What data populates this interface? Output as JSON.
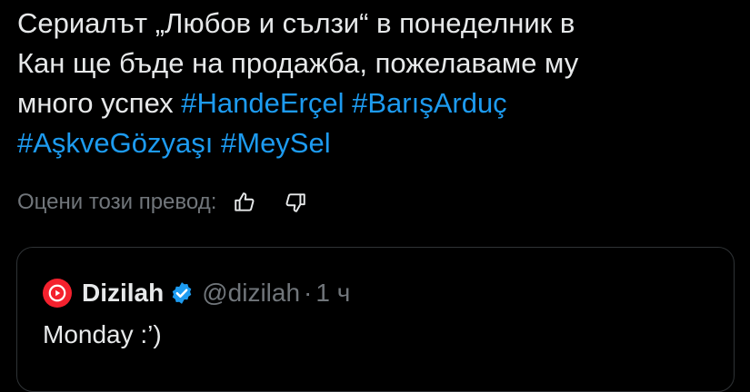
{
  "tweet": {
    "line1": "Сериалът „Любов и сълзи“ в понеделник в",
    "line2": "Кан ще бъде на продажба, пожелаваме му",
    "line3_text": "много успех ",
    "hashtags": [
      "#HandeErçel",
      "#BarışArduç",
      "#AşkveGözyaşı",
      "#MeySel"
    ]
  },
  "translation_rating": {
    "label": "Оцени този превод:",
    "thumbs_up_icon": "thumbs-up-icon",
    "thumbs_down_icon": "thumbs-down-icon"
  },
  "quoted_tweet": {
    "display_name": "Dizilah",
    "handle": "@dizilah",
    "separator": "·",
    "time": "1 ч",
    "text": "Monday :’)",
    "avatar_color": "#f4212e",
    "verified_color": "#1d9bf0"
  },
  "colors": {
    "background": "#000000",
    "text": "#e7e9ea",
    "muted": "#71767b",
    "link": "#1d9bf0",
    "border": "#2f3336"
  }
}
